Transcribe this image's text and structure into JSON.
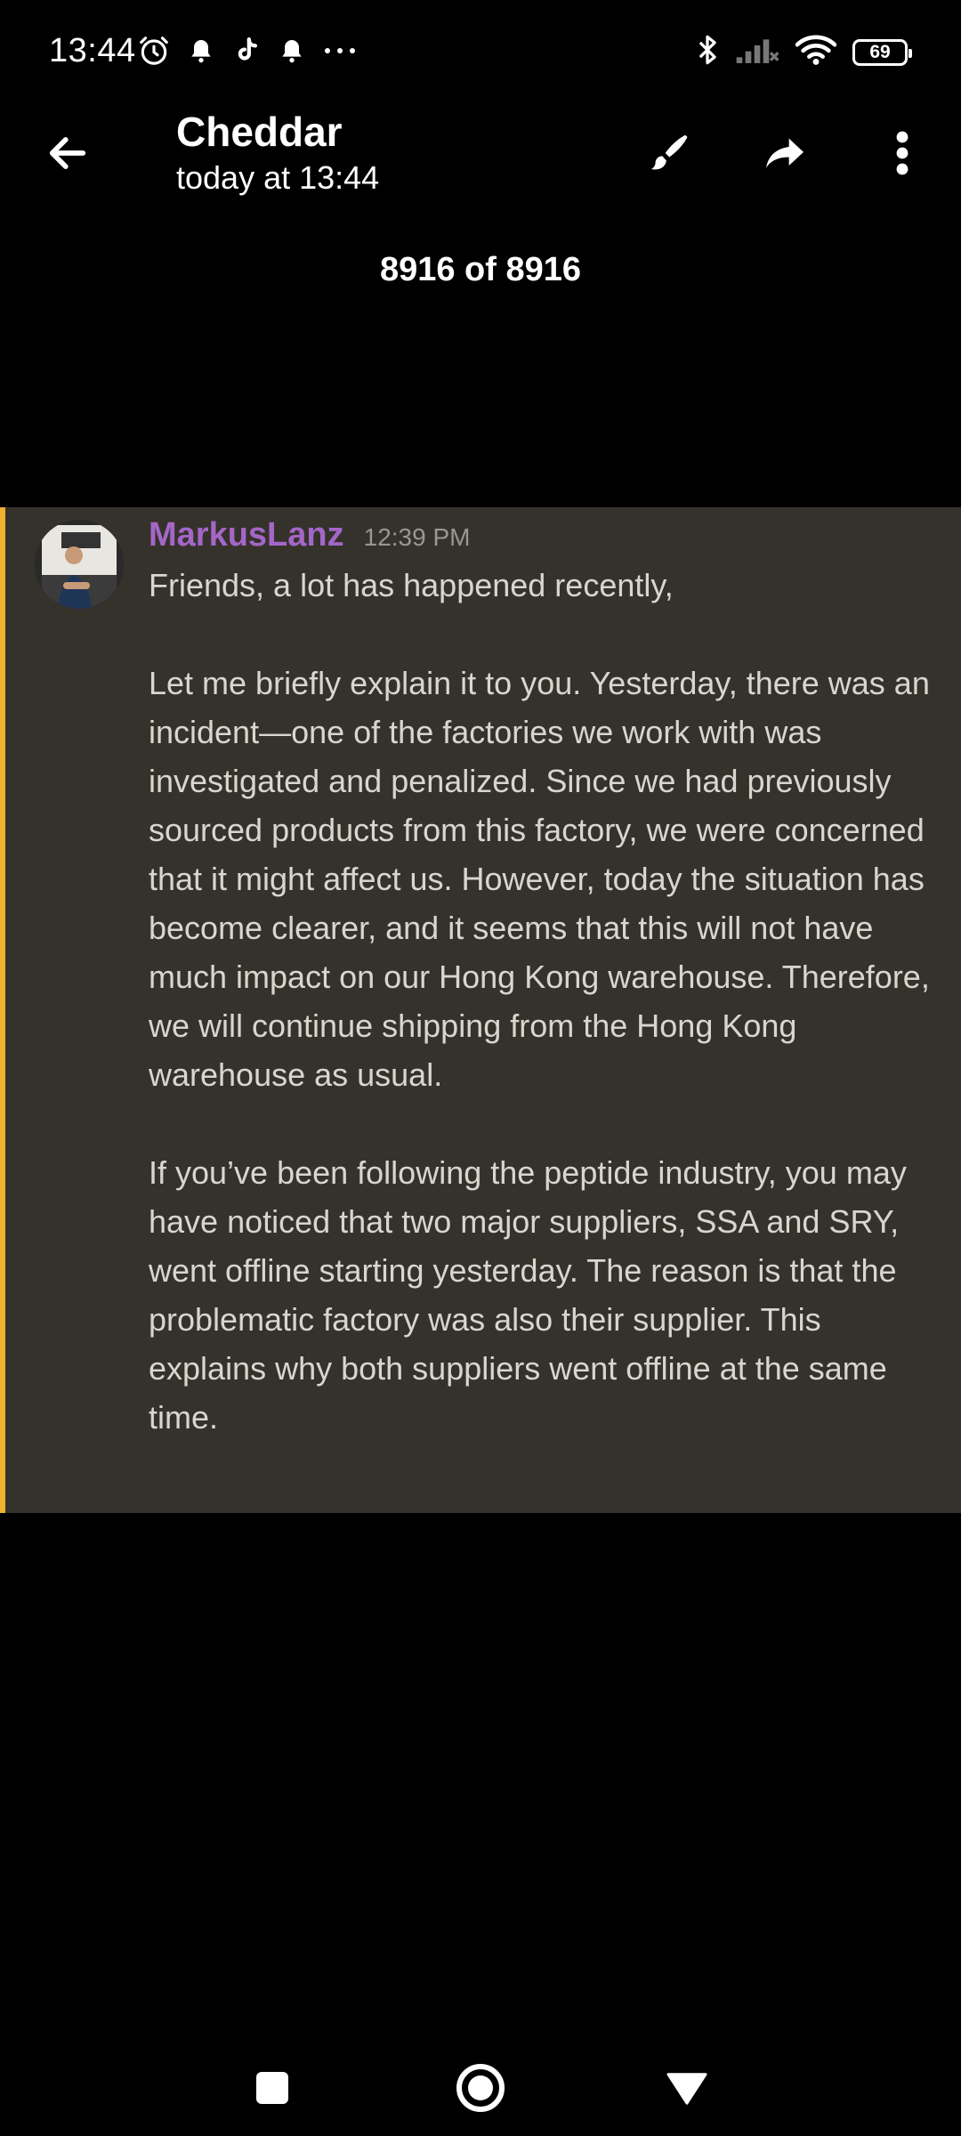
{
  "status_bar": {
    "time": "13:44",
    "battery": "69",
    "icons_left": [
      "alarm-icon",
      "bell-icon",
      "tiktok-icon",
      "bell-icon",
      "more-dots-icon"
    ],
    "icons_right": [
      "bluetooth-icon",
      "signal-icon",
      "wifi-icon",
      "battery-icon"
    ]
  },
  "header": {
    "title": "Cheddar",
    "subtitle": "today at 13:44",
    "actions": [
      "brush-icon",
      "share-icon",
      "more-vertical-icon"
    ]
  },
  "counter": "8916 of 8916",
  "message": {
    "username": "MarkusLanz",
    "time": "12:39 PM",
    "paragraphs": [
      "Friends, a lot has happened recently,",
      "Let me briefly explain it to you. Yesterday, there was an incident—one of the factories we work with was investigated and penalized. Since we had previously sourced products from this factory, we were concerned that it might affect us. However, today the situation has become clearer, and it seems that this will not have much impact on our Hong Kong warehouse. Therefore, we will continue shipping from the Hong Kong warehouse as usual.",
      "If you’ve been following the peptide industry, you may have noticed that two major suppliers, SSA and SRY, went offline starting yesterday. The reason is that the problematic factory was also their supplier. This explains why both suppliers went offline at the same time."
    ]
  },
  "colors": {
    "background": "#000000",
    "card": "#35322b",
    "accent_bar": "#f0b132",
    "username": "#a466c8",
    "body_text": "#d9d6cf"
  },
  "nav_bar": [
    "recents-icon",
    "home-icon",
    "back-triangle-icon"
  ]
}
